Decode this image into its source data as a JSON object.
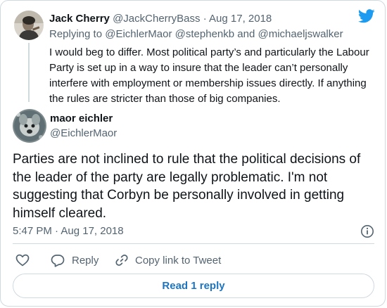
{
  "parent_tweet": {
    "display_name": "Jack Cherry",
    "handle": "@JackCherryBass",
    "separator": "·",
    "date": "Aug 17, 2018",
    "replying_prefix": "Replying to",
    "mentions": [
      "@EichlerMaor",
      "@stephenkb",
      "@michaeljswalker"
    ],
    "mention_join": "and",
    "text": "I would beg to differ. Most political party’s and particularly the Labour Party is set up in a way to insure that the leader can’t personally interfere with employment or membership issues directly. If anything the rules are stricter than those of big companies."
  },
  "main_tweet": {
    "display_name": "maor eichler",
    "handle": "@EichlerMaor",
    "text": "Parties are not inclined to rule that the political decisions of the leader of the party are legally problematic. I'm not suggesting that Corbyn be personally involved in getting himself cleared.",
    "timestamp": "5:47 PM · Aug 17, 2018"
  },
  "actions": {
    "like_icon": "heart-icon",
    "reply_label": "Reply",
    "reply_icon": "speech-bubble-icon",
    "copy_label": "Copy link to Tweet",
    "copy_icon": "link-icon"
  },
  "read_replies_label": "Read 1 reply",
  "icons": {
    "brand": "twitter-bird-icon",
    "info": "info-icon"
  },
  "colors": {
    "brand_blue": "#1d9bf0",
    "text_primary": "#0f1419",
    "text_secondary": "#536471",
    "border": "#cfd9de",
    "link_blue": "#1d75c2"
  }
}
